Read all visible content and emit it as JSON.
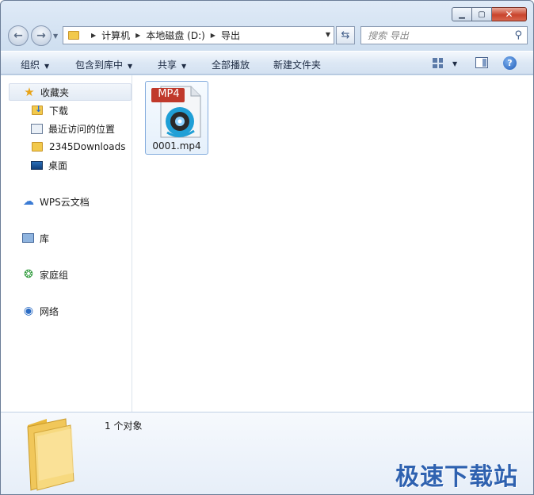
{
  "address": {
    "crumbs": [
      "计算机",
      "本地磁盘 (D:)",
      "导出"
    ]
  },
  "search": {
    "placeholder": "搜索 导出"
  },
  "toolbar": {
    "organize": "组织",
    "include_in_library": "包含到库中",
    "share": "共享",
    "play_all": "全部播放",
    "new_folder": "新建文件夹"
  },
  "sidebar": {
    "favorites": "收藏夹",
    "favorites_items": [
      "下载",
      "最近访问的位置",
      "2345Downloads",
      "桌面"
    ],
    "wps_cloud": "WPS云文档",
    "libraries": "库",
    "homegroup": "家庭组",
    "network": "网络"
  },
  "files": [
    {
      "name": "0001.mp4",
      "badge": "MP4"
    }
  ],
  "status": {
    "count": "1 个对象"
  },
  "watermark": "极速下载站",
  "colors": {
    "accent": "#2f62b0",
    "badge": "#c0392b"
  }
}
